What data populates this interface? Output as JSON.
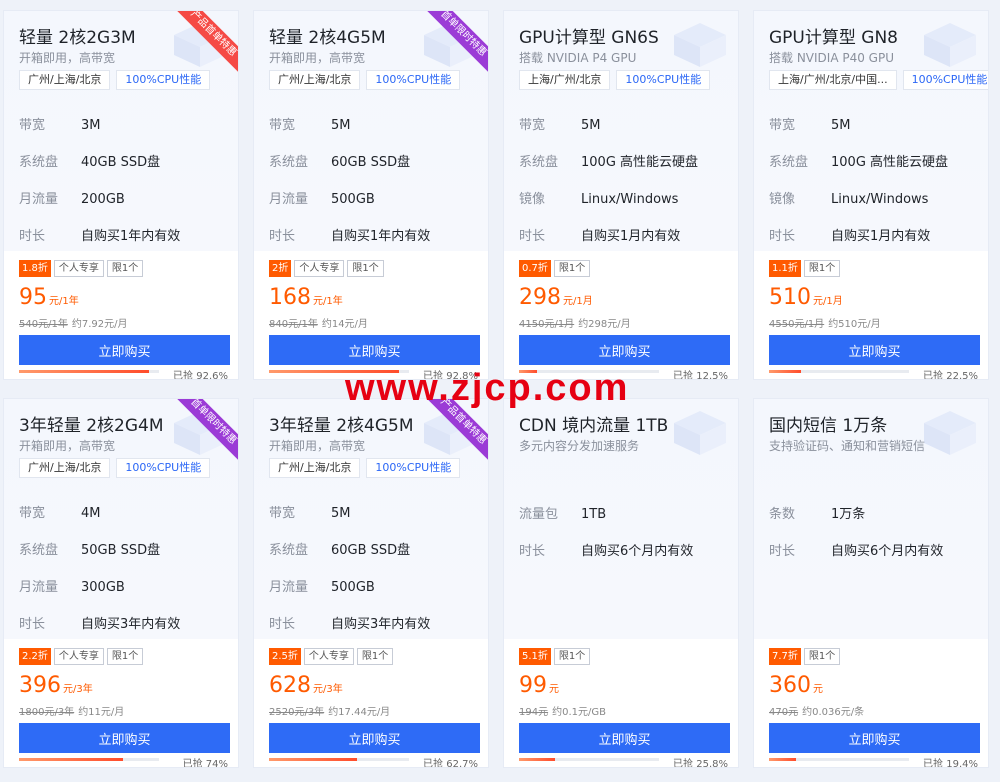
{
  "watermark": "www.zjcp.com",
  "cards": [
    {
      "title": "轻量 2核2G3M",
      "subtitle": "开箱即用，高带宽",
      "tags": [
        "广州/上海/北京",
        "100%CPU性能"
      ],
      "ribbon": "产品首单特惠",
      "ribbon_color": "#f54a45",
      "specs": [
        [
          "带宽",
          "3M"
        ],
        [
          "系统盘",
          "40GB SSD盘"
        ],
        [
          "月流量",
          "200GB"
        ],
        [
          "时长",
          "自购买1年内有效"
        ]
      ],
      "discount": "1.8折",
      "badges": [
        "个人专享",
        "限1个"
      ],
      "price": "95",
      "price_unit": "元/1年",
      "orig_price": "540元/1年",
      "per_unit": "约7.92元/月",
      "button": "立即购买",
      "progress_pct": 92.6,
      "progress_text": "已抢 92.6%"
    },
    {
      "title": "轻量 2核4G5M",
      "subtitle": "开箱即用，高带宽",
      "tags": [
        "广州/上海/北京",
        "100%CPU性能"
      ],
      "ribbon": "首单限时特惠",
      "ribbon_color": "#9b3bd6",
      "specs": [
        [
          "带宽",
          "5M"
        ],
        [
          "系统盘",
          "60GB SSD盘"
        ],
        [
          "月流量",
          "500GB"
        ],
        [
          "时长",
          "自购买1年内有效"
        ]
      ],
      "discount": "2折",
      "badges": [
        "个人专享",
        "限1个"
      ],
      "price": "168",
      "price_unit": "元/1年",
      "orig_price": "840元/1年",
      "per_unit": "约14元/月",
      "button": "立即购买",
      "progress_pct": 92.8,
      "progress_text": "已抢 92.8%"
    },
    {
      "title": "GPU计算型 GN6S",
      "subtitle": "搭载 NVIDIA P4 GPU",
      "tags": [
        "上海/广州/北京",
        "100%CPU性能"
      ],
      "ribbon": "",
      "ribbon_color": "",
      "specs": [
        [
          "带宽",
          "5M"
        ],
        [
          "系统盘",
          "100G 高性能云硬盘"
        ],
        [
          "镜像",
          "Linux/Windows"
        ],
        [
          "时长",
          "自购买1月内有效"
        ]
      ],
      "discount": "0.7折",
      "badges": [
        "限1个"
      ],
      "price": "298",
      "price_unit": "元/1月",
      "orig_price": "4150元/1月",
      "per_unit": "约298元/月",
      "button": "立即购买",
      "progress_pct": 12.5,
      "progress_text": "已抢 12.5%"
    },
    {
      "title": "GPU计算型 GN8",
      "subtitle": "搭载 NVIDIA P40 GPU",
      "tags": [
        "上海/广州/北京/中国...",
        "100%CPU性能"
      ],
      "ribbon": "",
      "ribbon_color": "",
      "specs": [
        [
          "带宽",
          "5M"
        ],
        [
          "系统盘",
          "100G 高性能云硬盘"
        ],
        [
          "镜像",
          "Linux/Windows"
        ],
        [
          "时长",
          "自购买1月内有效"
        ]
      ],
      "discount": "1.1折",
      "badges": [
        "限1个"
      ],
      "price": "510",
      "price_unit": "元/1月",
      "orig_price": "4550元/1月",
      "per_unit": "约510元/月",
      "button": "立即购买",
      "progress_pct": 22.5,
      "progress_text": "已抢 22.5%"
    },
    {
      "title": "3年轻量 2核2G4M",
      "subtitle": "开箱即用，高带宽",
      "tags": [
        "广州/上海/北京",
        "100%CPU性能"
      ],
      "ribbon": "首单限时特惠",
      "ribbon_color": "#9b3bd6",
      "specs": [
        [
          "带宽",
          "4M"
        ],
        [
          "系统盘",
          "50GB SSD盘"
        ],
        [
          "月流量",
          "300GB"
        ],
        [
          "时长",
          "自购买3年内有效"
        ]
      ],
      "discount": "2.2折",
      "badges": [
        "个人专享",
        "限1个"
      ],
      "price": "396",
      "price_unit": "元/3年",
      "orig_price": "1800元/3年",
      "per_unit": "约11元/月",
      "button": "立即购买",
      "progress_pct": 74,
      "progress_text": "已抢 74%"
    },
    {
      "title": "3年轻量 2核4G5M",
      "subtitle": "开箱即用，高带宽",
      "tags": [
        "广州/上海/北京",
        "100%CPU性能"
      ],
      "ribbon": "产品首单特惠",
      "ribbon_color": "#9b3bd6",
      "specs": [
        [
          "带宽",
          "5M"
        ],
        [
          "系统盘",
          "60GB SSD盘"
        ],
        [
          "月流量",
          "500GB"
        ],
        [
          "时长",
          "自购买3年内有效"
        ]
      ],
      "discount": "2.5折",
      "badges": [
        "个人专享",
        "限1个"
      ],
      "price": "628",
      "price_unit": "元/3年",
      "orig_price": "2520元/3年",
      "per_unit": "约17.44元/月",
      "button": "立即购买",
      "progress_pct": 62.7,
      "progress_text": "已抢 62.7%"
    },
    {
      "title": "CDN 境内流量 1TB",
      "subtitle": "多元内容分发加速服务",
      "tags": [],
      "ribbon": "",
      "ribbon_color": "",
      "specs": [
        [
          "流量包",
          "1TB"
        ],
        [
          "时长",
          "自购买6个月内有效"
        ]
      ],
      "discount": "5.1折",
      "badges": [
        "限1个"
      ],
      "price": "99",
      "price_unit": "元",
      "orig_price": "194元",
      "per_unit": "约0.1元/GB",
      "button": "立即购买",
      "progress_pct": 25.8,
      "progress_text": "已抢 25.8%"
    },
    {
      "title": "国内短信 1万条",
      "subtitle": "支持验证码、通知和营销短信",
      "tags": [],
      "ribbon": "",
      "ribbon_color": "",
      "specs": [
        [
          "条数",
          "1万条"
        ],
        [
          "时长",
          "自购买6个月内有效"
        ]
      ],
      "discount": "7.7折",
      "badges": [
        "限1个"
      ],
      "price": "360",
      "price_unit": "元",
      "orig_price": "470元",
      "per_unit": "约0.036元/条",
      "button": "立即购买",
      "progress_pct": 19.4,
      "progress_text": "已抢 19.4%"
    }
  ]
}
